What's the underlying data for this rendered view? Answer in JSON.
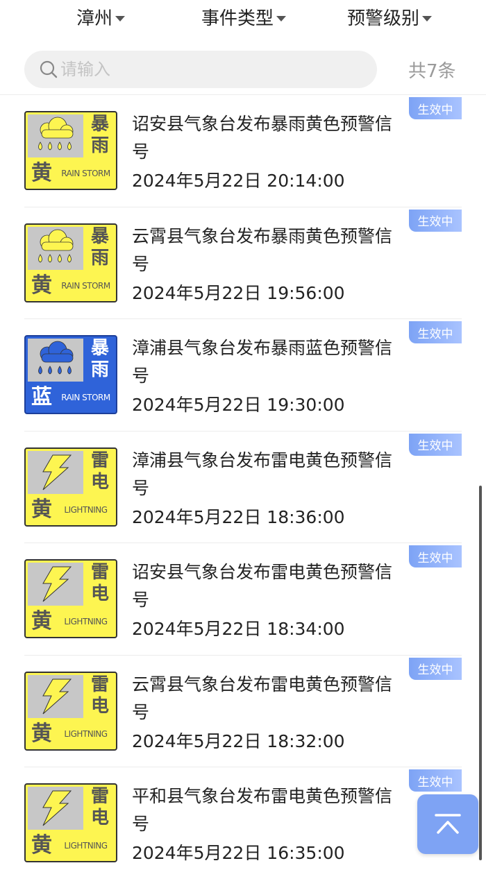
{
  "filters": {
    "city": "漳州",
    "event_type": "事件类型",
    "level": "预警级别"
  },
  "search": {
    "placeholder": "请输入",
    "icon": "search-icon"
  },
  "count_text": "共7条",
  "status_label": "生效中",
  "colors": {
    "yellow": "#fdf551",
    "blue": "#2f63d9",
    "gray": "#c7c7c7",
    "badge": "#8fb0f7"
  },
  "warnings": [
    {
      "title": "诏安县气象台发布暴雨黄色预警信号",
      "time": "2024年5月22日 20:14:00",
      "type": "rainstorm",
      "type_chars": [
        "暴",
        "雨"
      ],
      "level_char": "黄",
      "english": "RAIN STORM",
      "level": "yellow",
      "status": "生效中"
    },
    {
      "title": "云霄县气象台发布暴雨黄色预警信号",
      "time": "2024年5月22日 19:56:00",
      "type": "rainstorm",
      "type_chars": [
        "暴",
        "雨"
      ],
      "level_char": "黄",
      "english": "RAIN STORM",
      "level": "yellow",
      "status": "生效中"
    },
    {
      "title": "漳浦县气象台发布暴雨蓝色预警信号",
      "time": "2024年5月22日 19:30:00",
      "type": "rainstorm",
      "type_chars": [
        "暴",
        "雨"
      ],
      "level_char": "蓝",
      "english": "RAIN STORM",
      "level": "blue",
      "status": "生效中"
    },
    {
      "title": "漳浦县气象台发布雷电黄色预警信号",
      "time": "2024年5月22日 18:36:00",
      "type": "lightning",
      "type_chars": [
        "雷",
        "电"
      ],
      "level_char": "黄",
      "english": "LIGHTNING",
      "level": "yellow",
      "status": "生效中"
    },
    {
      "title": "诏安县气象台发布雷电黄色预警信号",
      "time": "2024年5月22日 18:34:00",
      "type": "lightning",
      "type_chars": [
        "雷",
        "电"
      ],
      "level_char": "黄",
      "english": "LIGHTNING",
      "level": "yellow",
      "status": "生效中"
    },
    {
      "title": "云霄县气象台发布雷电黄色预警信号",
      "time": "2024年5月22日 18:32:00",
      "type": "lightning",
      "type_chars": [
        "雷",
        "电"
      ],
      "level_char": "黄",
      "english": "LIGHTNING",
      "level": "yellow",
      "status": "生效中"
    },
    {
      "title": "平和县气象台发布雷电黄色预警信号",
      "time": "2024年5月22日 16:35:00",
      "type": "lightning",
      "type_chars": [
        "雷",
        "电"
      ],
      "level_char": "黄",
      "english": "LIGHTNING",
      "level": "yellow",
      "status": "生效中"
    }
  ],
  "back_to_top": {
    "icon": "arrow-up-icon"
  }
}
